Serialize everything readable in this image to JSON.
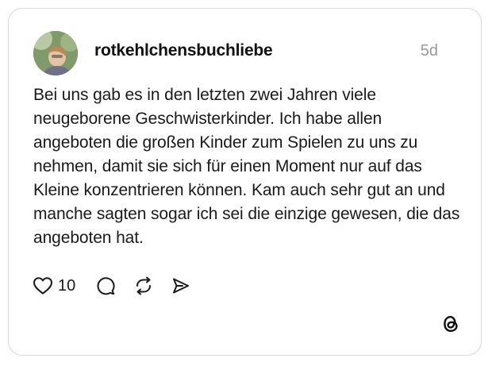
{
  "post": {
    "username": "rotkehlchensbuchliebe",
    "timestamp": "5d",
    "text": "Bei uns gab es in den letzten zwei Jahren viele neugeborene Geschwisterkinder. Ich habe allen angeboten die großen Kinder zum Spielen zu uns zu nehmen, damit sie sich für einen Moment nur auf das Kleine konzentrieren können. Kam auch sehr gut an und manche sagten sogar ich sei die einzige gewesen, die das angeboten hat."
  },
  "actions": {
    "like_count": "10",
    "icons": [
      "heart-icon",
      "comment-icon",
      "repost-icon",
      "share-icon"
    ]
  },
  "branding": {
    "logo": "threads-logo-icon"
  },
  "colors": {
    "text": "#1a1a1a",
    "muted": "#9a9a9a",
    "border": "#d9d9d9"
  }
}
